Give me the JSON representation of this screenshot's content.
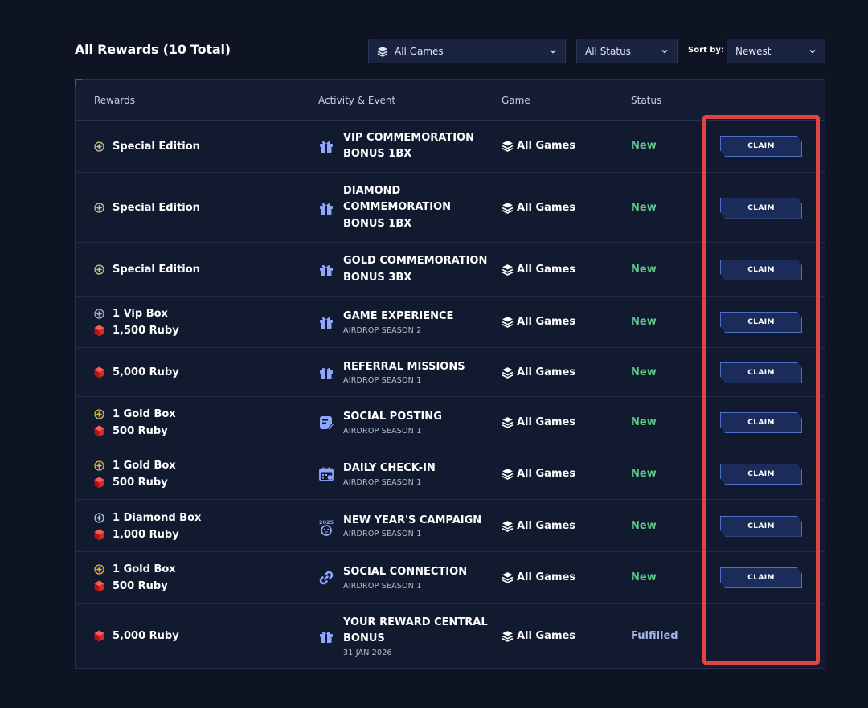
{
  "header": {
    "title": "All Rewards (10 Total)",
    "game_filter": "All Games",
    "status_filter": "All Status",
    "sort_label": "Sort by:",
    "sort_value": "Newest"
  },
  "columns": {
    "rewards": "Rewards",
    "activity": "Activity & Event",
    "game": "Game",
    "status": "Status"
  },
  "claim_label": "CLAIM",
  "colors": {
    "status_new": "#5fc98b",
    "status_fulfilled": "#a7b4e6",
    "accent": "#4e6fc7",
    "highlight": "#e04545"
  },
  "rows": [
    {
      "rewards": [
        {
          "icon": "special-edition-icon",
          "text": "Special Edition"
        }
      ],
      "activity_icon": "gift-icon",
      "activity_title": [
        "VIP COMMEMORATION",
        "BONUS 1BX"
      ],
      "activity_sub": "",
      "game": "All Games",
      "status": "New",
      "claimable": true
    },
    {
      "rewards": [
        {
          "icon": "special-edition-icon",
          "text": "Special Edition"
        }
      ],
      "activity_icon": "gift-icon",
      "activity_title": [
        "DIAMOND",
        "COMMEMORATION",
        "BONUS 1BX"
      ],
      "activity_sub": "",
      "game": "All Games",
      "status": "New",
      "claimable": true
    },
    {
      "rewards": [
        {
          "icon": "special-edition-icon",
          "text": "Special Edition"
        }
      ],
      "activity_icon": "gift-icon",
      "activity_title": [
        "GOLD COMMEMORATION",
        "BONUS 3BX"
      ],
      "activity_sub": "",
      "game": "All Games",
      "status": "New",
      "claimable": true
    },
    {
      "rewards": [
        {
          "icon": "vip-box-icon",
          "text": "1 Vip Box"
        },
        {
          "icon": "ruby-icon",
          "text": "1,500 Ruby"
        }
      ],
      "activity_icon": "gift-icon",
      "activity_title": [
        "GAME EXPERIENCE"
      ],
      "activity_sub": "AIRDROP SEASON 2",
      "game": "All Games",
      "status": "New",
      "claimable": true
    },
    {
      "rewards": [
        {
          "icon": "ruby-icon",
          "text": "5,000 Ruby"
        }
      ],
      "activity_icon": "gift-icon",
      "activity_title": [
        "REFERRAL MISSIONS"
      ],
      "activity_sub": "AIRDROP SEASON 1",
      "game": "All Games",
      "status": "New",
      "claimable": true
    },
    {
      "rewards": [
        {
          "icon": "gold-box-icon",
          "text": "1 Gold Box"
        },
        {
          "icon": "ruby-icon",
          "text": "500 Ruby"
        }
      ],
      "activity_icon": "social-post-icon",
      "activity_title": [
        "SOCIAL POSTING"
      ],
      "activity_sub": "AIRDROP SEASON 1",
      "game": "All Games",
      "status": "New",
      "claimable": true
    },
    {
      "rewards": [
        {
          "icon": "gold-box-icon",
          "text": "1 Gold Box"
        },
        {
          "icon": "ruby-icon",
          "text": "500 Ruby"
        }
      ],
      "activity_icon": "calendar-icon",
      "activity_title": [
        "DAILY CHECK-IN"
      ],
      "activity_sub": "AIRDROP SEASON 1",
      "game": "All Games",
      "status": "New",
      "claimable": true
    },
    {
      "rewards": [
        {
          "icon": "diamond-box-icon",
          "text": "1 Diamond Box"
        },
        {
          "icon": "ruby-icon",
          "text": "1,000 Ruby"
        }
      ],
      "activity_icon": "new-year-icon",
      "activity_title": [
        "NEW YEAR'S CAMPAIGN"
      ],
      "activity_sub": "AIRDROP SEASON 1",
      "game": "All Games",
      "status": "New",
      "claimable": true
    },
    {
      "rewards": [
        {
          "icon": "gold-box-icon",
          "text": "1 Gold Box"
        },
        {
          "icon": "ruby-icon",
          "text": "500 Ruby"
        }
      ],
      "activity_icon": "link-icon",
      "activity_title": [
        "SOCIAL CONNECTION"
      ],
      "activity_sub": "AIRDROP SEASON 1",
      "game": "All Games",
      "status": "New",
      "claimable": true
    },
    {
      "rewards": [
        {
          "icon": "ruby-icon",
          "text": "5,000 Ruby"
        }
      ],
      "activity_icon": "gift-icon",
      "activity_title": [
        "YOUR REWARD CENTRAL",
        "BONUS"
      ],
      "activity_sub": "31 JAN 2026",
      "game": "All Games",
      "status": "Fulfilled",
      "claimable": false
    }
  ]
}
